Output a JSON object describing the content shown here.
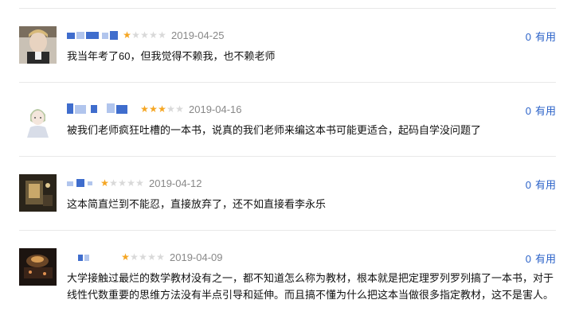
{
  "reviews": [
    {
      "stars": 1,
      "date": "2019-04-25",
      "content": "我当年考了60，但我觉得不赖我，也不赖老师",
      "useful_count": "0",
      "useful_label": "有用"
    },
    {
      "stars": 3,
      "date": "2019-04-16",
      "content": "被我们老师疯狂吐槽的一本书，说真的我们老师来编这本书可能更适合，起码自学没问题了",
      "useful_count": "0",
      "useful_label": "有用"
    },
    {
      "stars": 1,
      "date": "2019-04-12",
      "content": "这本简直烂到不能忍，直接放弃了，还不如直接看李永乐",
      "useful_count": "0",
      "useful_label": "有用"
    },
    {
      "stars": 1,
      "date": "2019-04-09",
      "content": "大学接触过最烂的数学教材没有之一，都不知道怎么称为教材，根本就是把定理罗列罗列搞了一本书，对于线性代数重要的思维方法没有半点引导和延伸。而且搞不懂为什么把这本当做很多指定教材，这不是害人。",
      "useful_count": "0",
      "useful_label": "有用"
    }
  ],
  "colors": {
    "star_on": "#f5a623",
    "star_off": "#d9d9d9",
    "link": "#2c63c9",
    "date": "#888888"
  }
}
